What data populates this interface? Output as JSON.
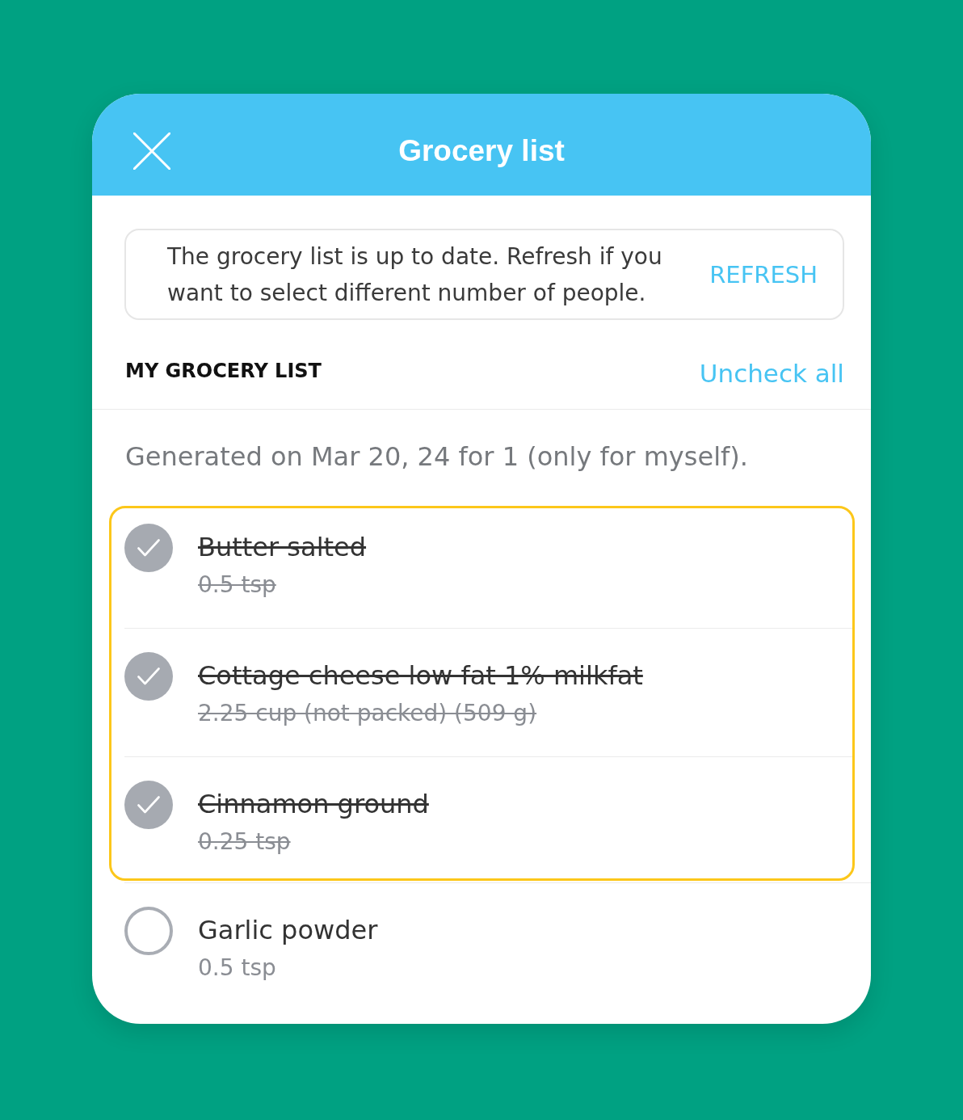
{
  "dialog": {
    "title": "Grocery list"
  },
  "notice": {
    "message": "The grocery list is up to date. Refresh if you want to select different number of people.",
    "action": "REFRESH"
  },
  "list_header": {
    "title": "MY GROCERY LIST",
    "action": "Uncheck all"
  },
  "generated_note": "Generated on Mar 20, 24 for 1 (only for myself).",
  "items": [
    {
      "name": "Butter salted",
      "amount": "0.5 tsp",
      "checked": true,
      "highlighted": true
    },
    {
      "name": "Cottage cheese low fat 1% milkfat",
      "amount": "2.25 cup (not packed) (509 g)",
      "checked": true,
      "highlighted": true
    },
    {
      "name": "Cinnamon ground",
      "amount": "0.25 tsp",
      "checked": true,
      "highlighted": true
    },
    {
      "name": "Garlic powder",
      "amount": "0.5 tsp",
      "checked": false,
      "highlighted": false
    }
  ]
}
